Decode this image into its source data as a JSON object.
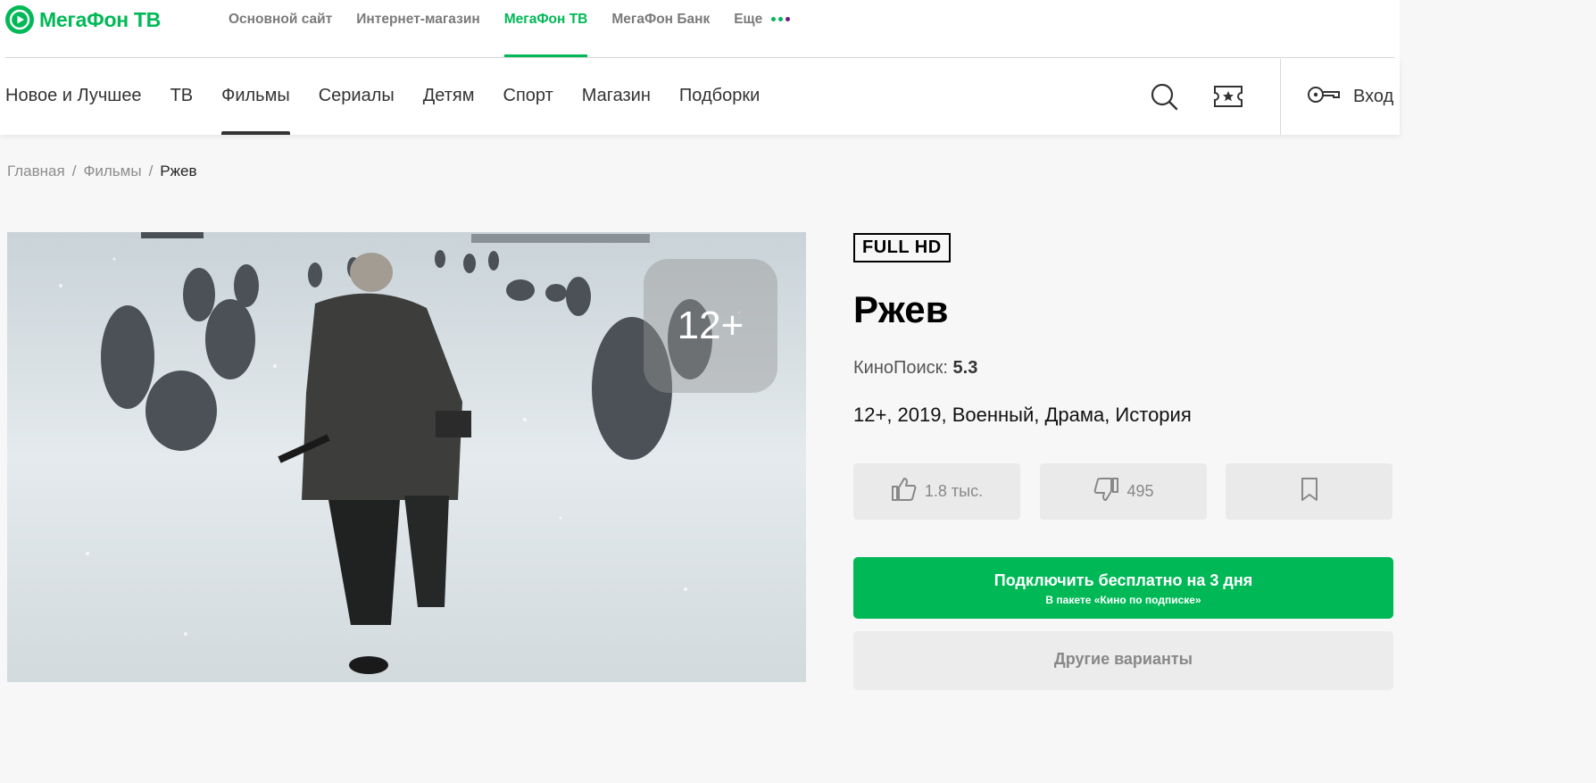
{
  "brand": {
    "logo_text": "МегаФон ТВ",
    "color": "#00b956"
  },
  "top_nav": {
    "items": [
      {
        "label": "Основной сайт"
      },
      {
        "label": "Интернет-магазин"
      },
      {
        "label": "МегаФон ТВ",
        "active": true
      },
      {
        "label": "МегаФон Банк"
      },
      {
        "label": "Еще"
      }
    ],
    "more_dots_colors": [
      "#00b956",
      "#00b956",
      "#731982"
    ]
  },
  "main_nav": {
    "items": [
      {
        "label": "Новое и Лучшее"
      },
      {
        "label": "ТВ"
      },
      {
        "label": "Фильмы",
        "active": true
      },
      {
        "label": "Сериалы"
      },
      {
        "label": "Детям"
      },
      {
        "label": "Спорт"
      },
      {
        "label": "Магазин"
      },
      {
        "label": "Подборки"
      }
    ],
    "icons": [
      "search-icon",
      "ticket-star-icon",
      "key-icon"
    ],
    "login_label": "Вход"
  },
  "breadcrumb": {
    "home": "Главная",
    "section": "Фильмы",
    "current": "Ржев",
    "separator": "/"
  },
  "poster": {
    "age_rating": "12+"
  },
  "movie": {
    "quality_badge": "FULL HD",
    "title": "Ржев",
    "rating_source": "КиноПоиск:",
    "rating_value": "5.3",
    "meta": "12+, 2019, Военный, Драма, История",
    "likes": "1.8 тыс.",
    "dislikes": "495"
  },
  "cta": {
    "main": "Подключить бесплатно на 3 дня",
    "sub": "В пакете «Кино по подписке»",
    "other": "Другие варианты"
  }
}
